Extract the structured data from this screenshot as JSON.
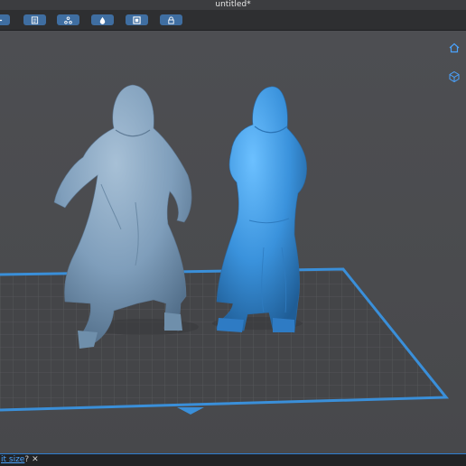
{
  "window": {
    "title": "untitled*"
  },
  "toolbar": {
    "buttons": [
      {
        "name": "add-icon"
      },
      {
        "name": "list-icon"
      },
      {
        "name": "nodes-icon"
      },
      {
        "name": "drop-icon"
      },
      {
        "name": "frame-icon"
      },
      {
        "name": "lock-icon"
      }
    ],
    "accent": "#3f6ea1"
  },
  "viewport": {
    "side_icons": [
      "home-icon",
      "cube-view-icon"
    ],
    "bed_outline_color": "#3a8fd9",
    "model_selected_color": "#3f9be2",
    "model_color": "#7e9fbd"
  },
  "status": {
    "link_text": "it size",
    "suffix": "?",
    "close": "✕"
  }
}
